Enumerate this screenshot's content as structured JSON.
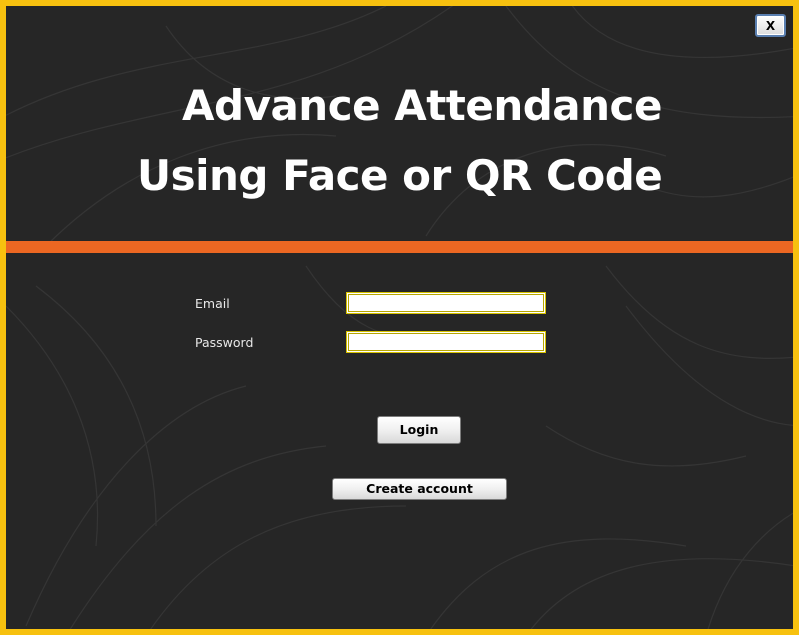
{
  "window": {
    "close_label": "X",
    "border_color": "#f7c10f",
    "background_color": "#262626"
  },
  "header": {
    "title_line1": "Advance Attendance",
    "title_line2": "Using Face or QR Code",
    "accent_color": "#ec6722"
  },
  "form": {
    "email_label": "Email",
    "email_value": "",
    "password_label": "Password",
    "password_value": "",
    "input_border_color": "#d6c200"
  },
  "actions": {
    "login_label": "Login",
    "create_account_label": "Create account"
  }
}
